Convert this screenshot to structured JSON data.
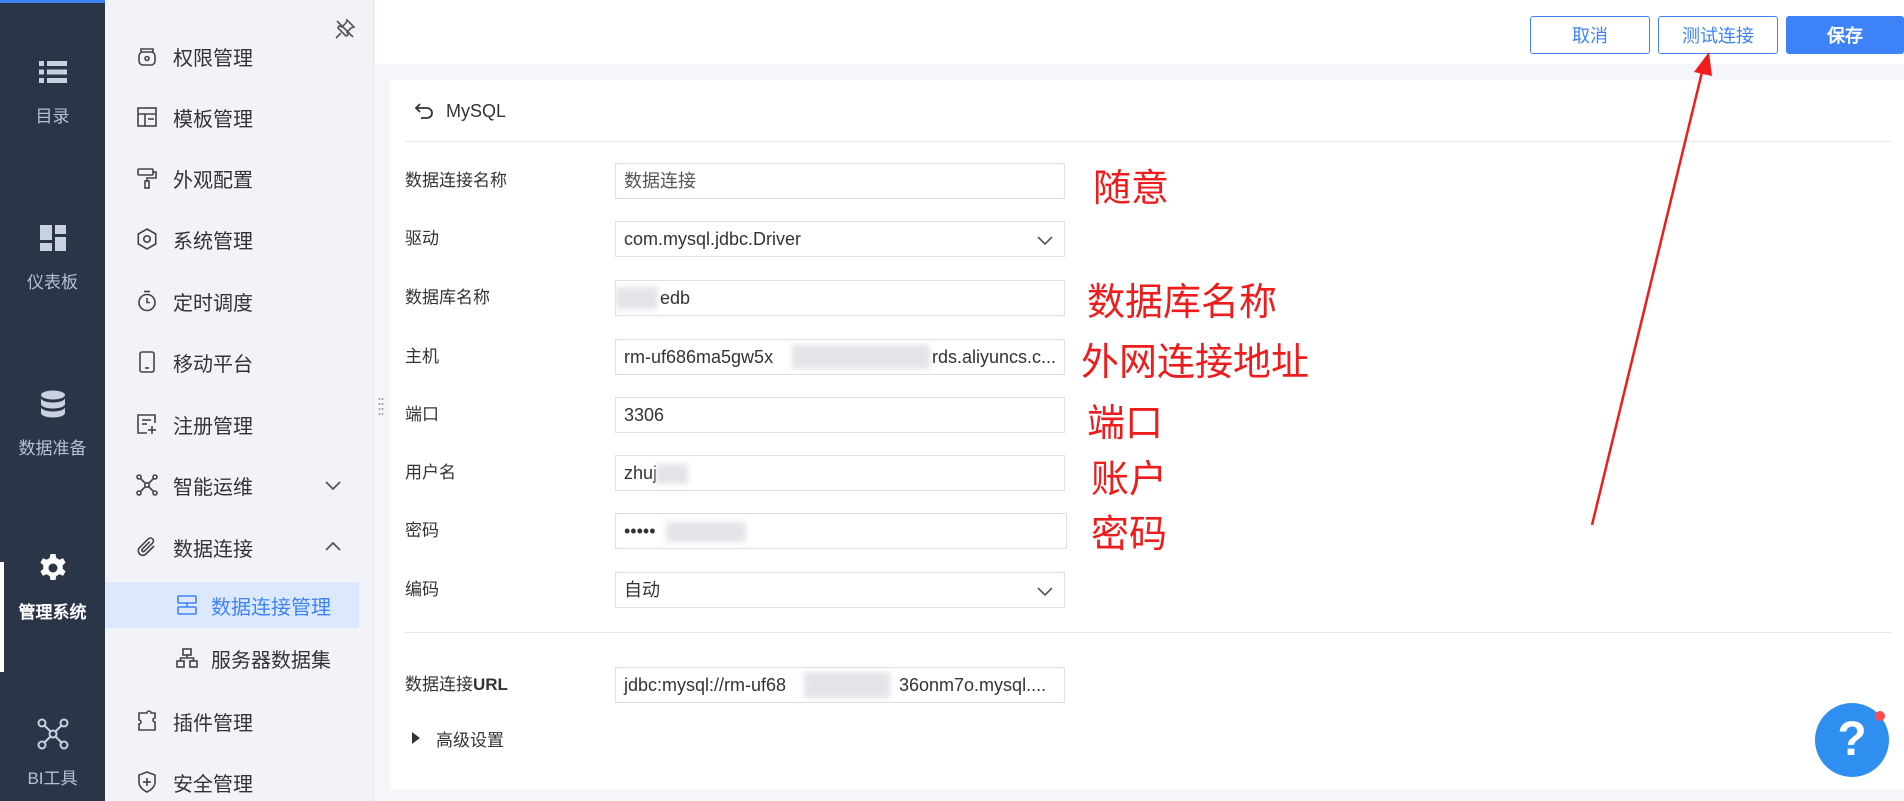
{
  "rail": {
    "items": [
      {
        "label": "目录",
        "icon": "list-icon"
      },
      {
        "label": "仪表板",
        "icon": "dashboard-icon"
      },
      {
        "label": "数据准备",
        "icon": "database-icon"
      },
      {
        "label": "管理系统",
        "icon": "gear-icon"
      },
      {
        "label": "BI工具",
        "icon": "network-icon"
      }
    ]
  },
  "submenu": {
    "items": [
      {
        "label": "权限管理",
        "icon": "permission-icon"
      },
      {
        "label": "模板管理",
        "icon": "template-icon"
      },
      {
        "label": "外观配置",
        "icon": "paint-roller-icon"
      },
      {
        "label": "系统管理",
        "icon": "settings-icon"
      },
      {
        "label": "定时调度",
        "icon": "timer-icon"
      },
      {
        "label": "移动平台",
        "icon": "mobile-icon"
      },
      {
        "label": "注册管理",
        "icon": "register-icon"
      },
      {
        "label": "智能运维",
        "icon": "ops-icon"
      },
      {
        "label": "数据连接",
        "icon": "paperclip-icon"
      },
      {
        "label": "插件管理",
        "icon": "plugin-icon"
      },
      {
        "label": "安全管理",
        "icon": "shield-icon"
      }
    ],
    "children": [
      {
        "label": "数据连接管理",
        "icon": "connection-manage-icon"
      },
      {
        "label": "服务器数据集",
        "icon": "server-dataset-icon"
      }
    ]
  },
  "toolbar": {
    "cancel_label": "取消",
    "test_label": "测试连接",
    "save_label": "保存"
  },
  "form": {
    "db_type": "MySQL",
    "fields": {
      "name": {
        "label": "数据连接名称",
        "value": "数据连接"
      },
      "driver": {
        "label": "驱动",
        "value": "com.mysql.jdbc.Driver"
      },
      "database": {
        "label": "数据库名称",
        "value": "edb"
      },
      "host": {
        "label": "主机",
        "value_start": "rm-uf686ma5gw5x",
        "value_end": "rds.aliyuncs.c..."
      },
      "port": {
        "label": "端口",
        "value": "3306"
      },
      "username": {
        "label": "用户名",
        "value": "zhuj"
      },
      "password": {
        "label": "密码",
        "value": "•••••"
      },
      "encoding": {
        "label": "编码",
        "value": "自动"
      },
      "url": {
        "label_prefix": "数据连接",
        "label_suffix": "URL",
        "value_start": "jdbc:mysql://rm-uf68",
        "value_end": "36onm7o.mysql...."
      }
    },
    "advanced_label": "高级设置"
  },
  "annotations": {
    "name": "随意",
    "database": "数据库名称",
    "host": "外网连接地址",
    "port": "端口",
    "username": "账户",
    "password": "密码"
  },
  "help": {
    "label": "?"
  },
  "colors": {
    "accent": "#3d83f7",
    "rail_bg": "#2b3548",
    "annotation_red": "#ee1c1c"
  }
}
